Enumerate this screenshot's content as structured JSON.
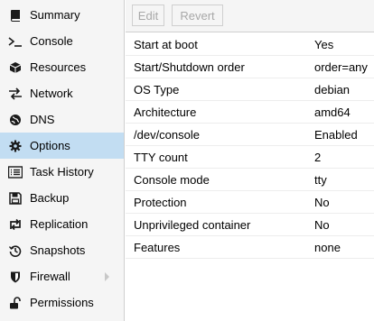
{
  "toolbar": {
    "edit_label": "Edit",
    "revert_label": "Revert"
  },
  "sidebar": {
    "items": [
      {
        "label": "Summary",
        "icon": "book-icon"
      },
      {
        "label": "Console",
        "icon": "terminal-icon"
      },
      {
        "label": "Resources",
        "icon": "cube-icon"
      },
      {
        "label": "Network",
        "icon": "exchange-icon"
      },
      {
        "label": "DNS",
        "icon": "globe-icon"
      },
      {
        "label": "Options",
        "icon": "gear-icon"
      },
      {
        "label": "Task History",
        "icon": "list-icon"
      },
      {
        "label": "Backup",
        "icon": "floppy-icon"
      },
      {
        "label": "Replication",
        "icon": "retweet-icon"
      },
      {
        "label": "Snapshots",
        "icon": "history-icon"
      },
      {
        "label": "Firewall",
        "icon": "shield-icon"
      },
      {
        "label": "Permissions",
        "icon": "unlock-icon"
      }
    ],
    "selected": "Options"
  },
  "options": [
    {
      "key": "Start at boot",
      "value": "Yes"
    },
    {
      "key": "Start/Shutdown order",
      "value": "order=any"
    },
    {
      "key": "OS Type",
      "value": "debian"
    },
    {
      "key": "Architecture",
      "value": "amd64"
    },
    {
      "key": "/dev/console",
      "value": "Enabled"
    },
    {
      "key": "TTY count",
      "value": "2"
    },
    {
      "key": "Console mode",
      "value": "tty"
    },
    {
      "key": "Protection",
      "value": "No"
    },
    {
      "key": "Unprivileged container",
      "value": "No"
    },
    {
      "key": "Features",
      "value": "none"
    }
  ],
  "colors": {
    "selected_bg": "#c2ddf2",
    "sidebar_bg": "#f5f5f5"
  }
}
